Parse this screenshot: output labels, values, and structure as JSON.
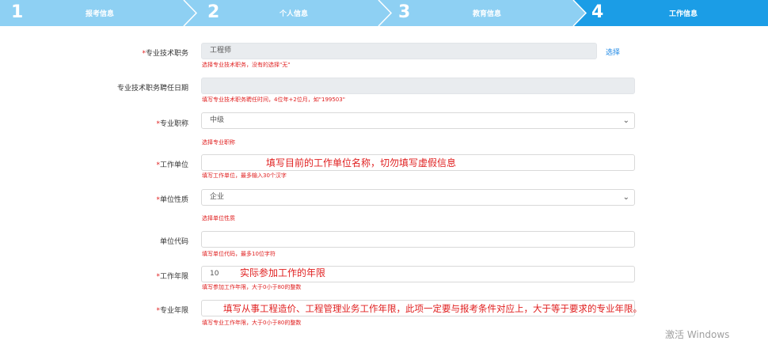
{
  "steps": [
    {
      "num": "1",
      "label": "报考信息"
    },
    {
      "num": "2",
      "label": "个人信息"
    },
    {
      "num": "3",
      "label": "教育信息"
    },
    {
      "num": "4",
      "label": "工作信息"
    }
  ],
  "colors": {
    "step_done": "#8ed0f3",
    "step_active": "#1b9de6",
    "required": "#e02020",
    "link": "#1e88e5"
  },
  "fields": {
    "title": {
      "label": "专业技术职务",
      "value": "工程师",
      "hint": "选择专业技术职务，没有的选择\"无\"",
      "link": "选择"
    },
    "appoint_date": {
      "label": "专业技术职务聘任日期",
      "value": "",
      "hint": "填写专业技术职务聘任时间，4位年+2位月，如\"199503\""
    },
    "level": {
      "label": "专业职称",
      "value": "中级",
      "hint": "选择专业职称"
    },
    "employer": {
      "label": "工作单位",
      "value": "",
      "hint": "填写工作单位，最多输入30个汉字",
      "annotation": "填写目前的工作单位名称，切勿填写虚假信息"
    },
    "unit_type": {
      "label": "单位性质",
      "value": "企业",
      "hint": "选择单位性质"
    },
    "unit_code": {
      "label": "单位代码",
      "value": "",
      "hint": "填写单位代码，最多10位字符"
    },
    "work_years": {
      "label": "工作年限",
      "value": "10",
      "hint": "填写参加工作年限，大于0小于80的整数",
      "annotation": "实际参加工作的年限"
    },
    "pro_years": {
      "label": "专业年限",
      "value": "",
      "hint": "填写专业工作年限，大于0小于80的整数",
      "annotation": "填写从事工程造价、工程管理业务工作年限，此项一定要与报考条件对应上，大于等于要求的专业年限。"
    }
  },
  "required_mark": "*",
  "watermark": "激活 Windows"
}
